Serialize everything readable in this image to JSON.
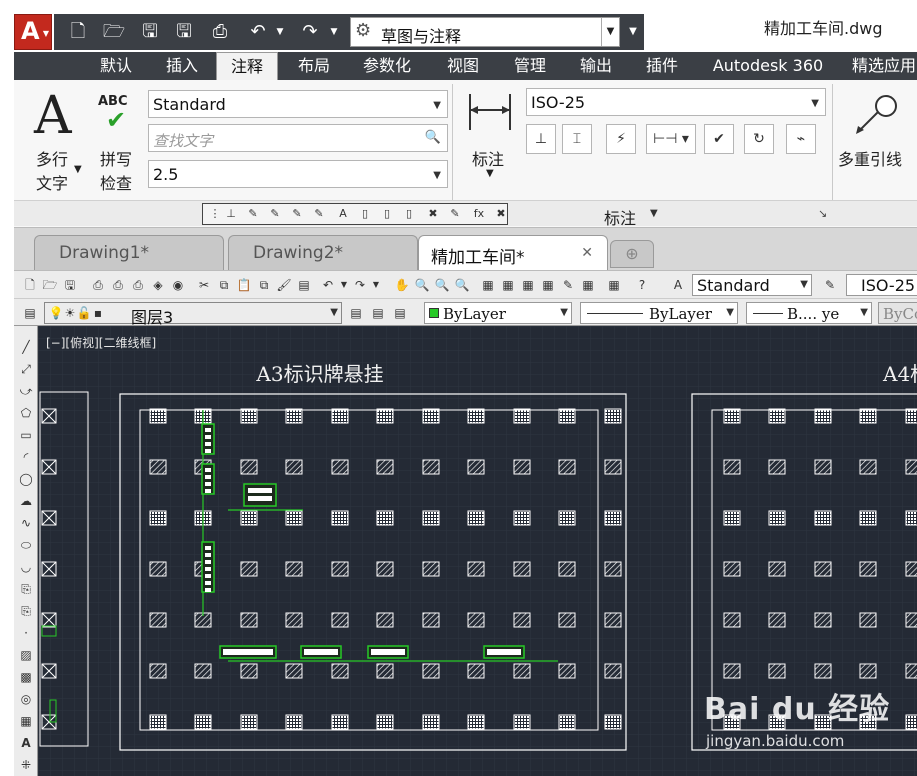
{
  "title_bar": {
    "app_button_glyph": "A",
    "workspace": "草图与注释",
    "document_title": "精加工车间.dwg"
  },
  "ribbon_tabs": [
    "默认",
    "插入",
    "注释",
    "布局",
    "参数化",
    "视图",
    "管理",
    "输出",
    "插件",
    "Autodesk 360",
    "精选应用"
  ],
  "active_ribbon_tab": "注释",
  "text_panel": {
    "multiline_text_line1": "多行",
    "multiline_text_line2": "文字",
    "spell_check_line1": "拼写",
    "spell_check_line2": "检查",
    "abc": "ABC",
    "text_style": "Standard",
    "find_text_placeholder": "查找文字",
    "text_height": "2.5"
  },
  "dimension_panel": {
    "label": "标注",
    "dim_style": "ISO-25",
    "footer_label": "标注"
  },
  "multileader_panel": {
    "label": "多重引线"
  },
  "document_tabs": [
    {
      "label": "Drawing1*"
    },
    {
      "label": "Drawing2*"
    },
    {
      "label": "精加工车间*"
    }
  ],
  "toolbar": {
    "text_style": "Standard",
    "dim_style": "ISO-25",
    "layer": "图层3",
    "color": "ByLayer",
    "linetype": "ByLayer",
    "lineweight": "B.... ye",
    "plot_style": "ByCo"
  },
  "viewport_label": "[−][俯视][二维线框]",
  "drawing": {
    "title_a3": "A3标识牌悬挂",
    "title_a4": "A4标"
  },
  "watermark": {
    "logo": "Bai du 经验",
    "url": "jingyan.baidu.com"
  },
  "colors": {
    "canvas": "#242a35",
    "ribbon_dark": "#3b3f45",
    "app_red": "#c3291e",
    "accent_green": "#27c927",
    "line_white": "#ffffff"
  }
}
